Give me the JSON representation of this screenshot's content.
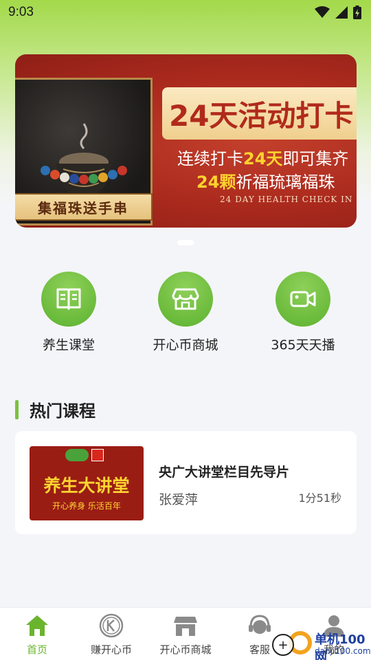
{
  "status_bar": {
    "time": "9:03"
  },
  "banner": {
    "tag": "集福珠送手串",
    "title": "24天活动打卡",
    "line1_prefix": "连续打卡",
    "line1_highlight": "24天",
    "line1_suffix": "即可集齐",
    "line2_highlight": "24颗",
    "line2_suffix": "祈福琉璃福珠",
    "english": "24 DAY HEALTH CHECK IN"
  },
  "quick_menu": [
    {
      "label": "养生课堂",
      "icon": "book-icon"
    },
    {
      "label": "开心币商城",
      "icon": "shop-icon"
    },
    {
      "label": "365天天播",
      "icon": "video-camera-icon"
    }
  ],
  "section": {
    "title": "热门课程"
  },
  "course": {
    "thumb_title": "养生大讲堂",
    "thumb_sub": "开心养身 乐活百年",
    "name": "央广大讲堂栏目先导片",
    "author": "张爱萍",
    "duration": "1分51秒"
  },
  "tabbar": {
    "items": [
      {
        "label": "首页",
        "icon": "home-icon",
        "active": true
      },
      {
        "label": "赚开心币",
        "icon": "coin-icon",
        "active": false
      },
      {
        "label": "开心币商城",
        "icon": "store-icon",
        "active": false
      },
      {
        "label": "客服",
        "icon": "customer-service-icon",
        "active": false
      },
      {
        "label": "我的",
        "icon": "user-icon",
        "active": false
      }
    ]
  },
  "watermark": {
    "text1": "单机100网",
    "text2": "danji100.com"
  },
  "colors": {
    "accent": "#6bb42e",
    "banner_red": "#a9291d",
    "highlight": "#ffd22e"
  }
}
